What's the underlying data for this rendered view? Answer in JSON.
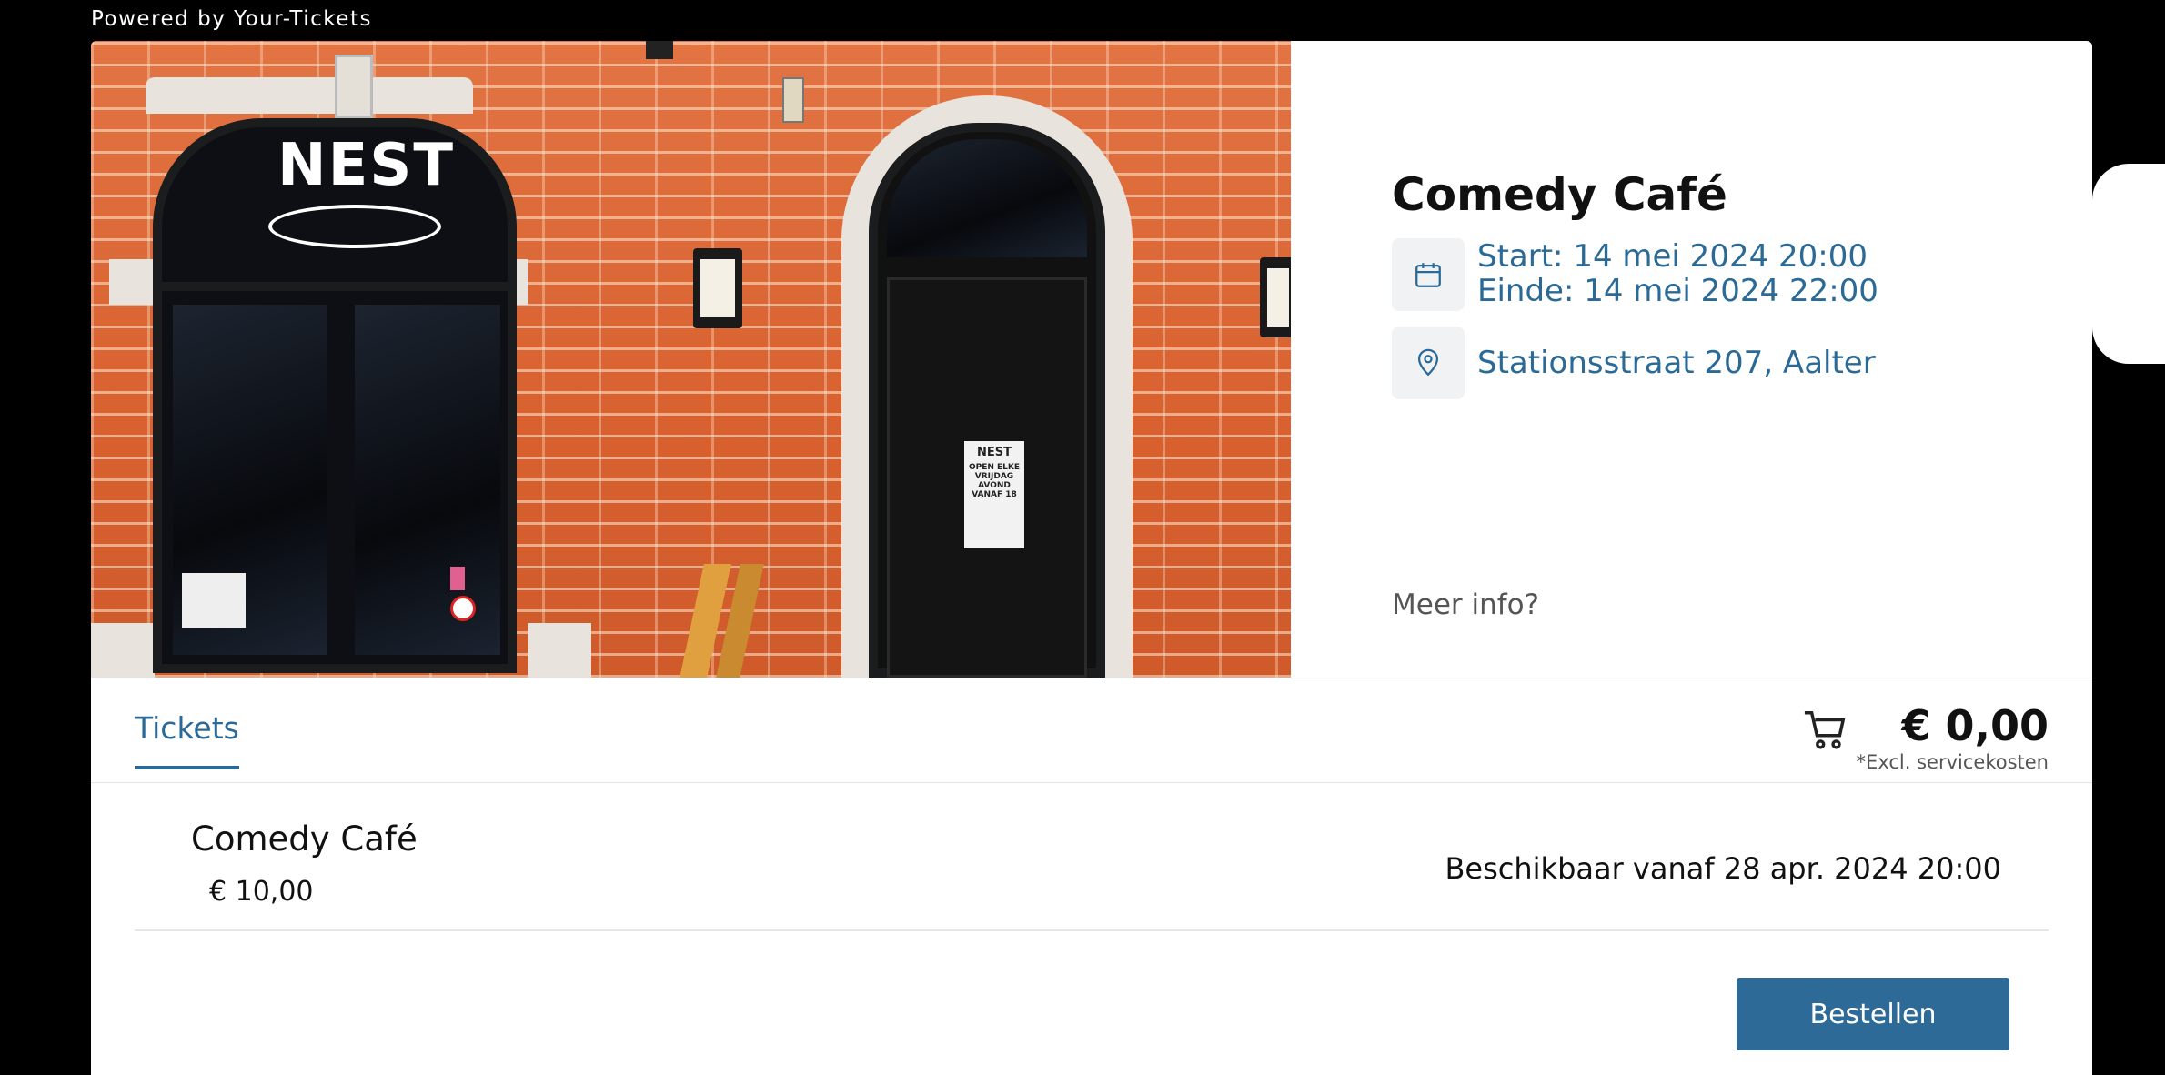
{
  "powered_by": "Powered by Your-Tickets",
  "event": {
    "title": "Comedy Café",
    "start": "Start: 14 mei 2024 20:00",
    "end": "Einde: 14 mei 2024 22:00",
    "location": "Stationsstraat 207, Aalter",
    "more_info": "Meer info?"
  },
  "hero": {
    "logo_text": "NEST",
    "door_poster_title": "NEST",
    "door_poster_text": "OPEN ELKE VRIJDAG AVOND VANAF 18"
  },
  "tabs": [
    {
      "label": "Tickets",
      "active": true
    }
  ],
  "cart": {
    "total": "€ 0,00",
    "note": "*Excl. servicekosten",
    "icon": "cart-icon"
  },
  "tickets": [
    {
      "name": "Comedy Café",
      "price": "€ 10,00",
      "availability": "Beschikbaar vanaf 28 apr. 2024 20:00"
    }
  ],
  "order_button": "Bestellen",
  "colors": {
    "accent": "#2b6a96",
    "button": "#2d6a98",
    "icon_bg": "#f1f2f4"
  }
}
